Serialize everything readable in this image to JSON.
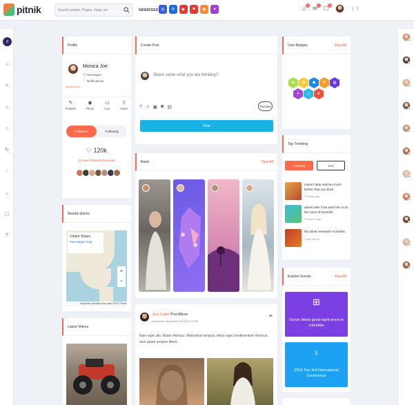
{
  "header": {
    "logo_text": "pitnik",
    "search_placeholder": "Search people, Pages, #tags etc",
    "newsfeed_label": "NEWSFEED",
    "app_icons": [
      {
        "name": "messenger-icon",
        "color": "#3b5bdb",
        "glyph": "◎"
      },
      {
        "name": "pinterest-icon",
        "color": "#1e6be6",
        "glyph": "℗"
      },
      {
        "name": "youtube-icon",
        "color": "#e53935",
        "glyph": "▶"
      },
      {
        "name": "bookmark-icon",
        "color": "#e53935",
        "glyph": "⚑"
      },
      {
        "name": "camera-icon",
        "color": "#ff8a2b",
        "glyph": "◉"
      },
      {
        "name": "thumb-icon",
        "color": "#a23fd6",
        "glyph": "✦"
      }
    ],
    "badges": {
      "notifications": "1",
      "messages": "2",
      "friends": "3"
    }
  },
  "profile": {
    "title": "Profile",
    "handle": "@shinchiva",
    "name": "Monica Joe",
    "messages_label": "Messages",
    "notifications_label": "Notifications",
    "stats": [
      {
        "name": "publish-stat",
        "label": "Publish",
        "icon": "✎"
      },
      {
        "name": "photo-stat",
        "label": "Photo",
        "icon": "◉"
      },
      {
        "name": "live-stat",
        "label": "Live",
        "icon": "▭"
      },
      {
        "name": "invite-stat",
        "label": "Invite",
        "icon": "⇧"
      }
    ],
    "tab_followers": "Followers",
    "tab_following": "Following",
    "follower_count": "♡ 120k",
    "new_followers": "22 new followers this week"
  },
  "nearby": {
    "title": "Nearby places",
    "map_place": "United States",
    "map_link": "View larger map",
    "map_footer": "Keyboard shortcuts  Map data ©2023  Terms"
  },
  "videos": {
    "title": "Latest Videos"
  },
  "create_post": {
    "title": "Create Post",
    "input_placeholder": "Share some what you are thinking?",
    "preview_label": "Preview",
    "post_label": "Post"
  },
  "reels": {
    "title": "Reels",
    "view_all": "View All"
  },
  "post": {
    "author": "Jack Carter",
    "action": "Post Album",
    "meta": "published: September,15 2020 19 PM",
    "body": "Nam eget ullo. Etiam rhoncus. Maecenas tempus, tellus eget condimentum rhoncus, sem quam semper libero."
  },
  "user_badges": {
    "title": "User Badges",
    "view_all": "View All"
  },
  "top_trending": {
    "title": "Top Trending",
    "tab_trending": "Trending",
    "tab_hot": "Hot",
    "items": [
      {
        "title": "moira's fade reaches much farther than you think.",
        "time": "2 weeks ago"
      },
      {
        "title": "daniel asks if we want him to do the voice of doomfist",
        "time": "3 months ago"
      },
      {
        "title": "the pitnik overwatch scandals.",
        "time": "1 day before"
      }
    ]
  },
  "events": {
    "title": "Explore Events",
    "view_all": "View All",
    "items": [
      {
        "title": "Ocean Motel good night event in columbia",
        "color": "#7b3fe4"
      },
      {
        "title": "2016 The 3rd International Conference",
        "color": "#1da1f2"
      }
    ]
  }
}
